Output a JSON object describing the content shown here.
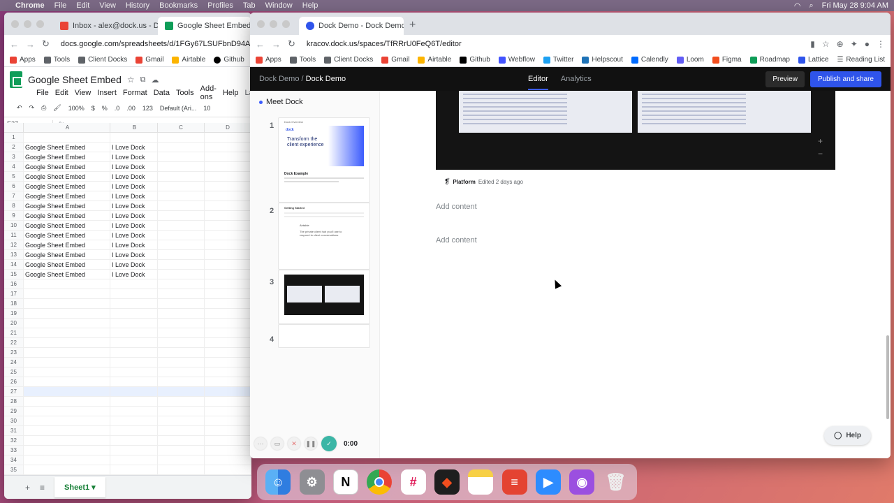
{
  "menubar": {
    "items": [
      "Chrome",
      "File",
      "Edit",
      "View",
      "History",
      "Bookmarks",
      "Profiles",
      "Tab",
      "Window",
      "Help"
    ],
    "clock": "Fri May 28  9:04 AM"
  },
  "sheets_window": {
    "tabs": [
      {
        "label": "Inbox - alex@dock.us - Dock M",
        "icon": "gmail-icon"
      },
      {
        "label": "Google Sheet Embed - Goog",
        "icon": "sheets-icon"
      }
    ],
    "url": "docs.google.com/spreadsheets/d/1FGy67LSUFbnD94AKgl",
    "bookmarks": [
      "Apps",
      "Tools",
      "Client Docks",
      "Gmail",
      "Airtable",
      "Github",
      "W"
    ],
    "doc_title": "Google Sheet Embed",
    "menus": [
      "File",
      "Edit",
      "View",
      "Insert",
      "Format",
      "Data",
      "Tools",
      "Add-ons",
      "Help",
      "La"
    ],
    "toolbar": {
      "zoom": "100%",
      "currency": "$",
      "percent": "%",
      "dec1": ".0",
      "dec2": ".00",
      "fmt": "123",
      "font": "Default (Ari...",
      "size": "10"
    },
    "cell_ref": "E27",
    "fx": "fx",
    "columns": [
      "A",
      "B",
      "C",
      "D"
    ],
    "rows": [
      {
        "n": "1",
        "a": "",
        "b": ""
      },
      {
        "n": "2",
        "a": "Google Sheet Embed",
        "b": "I Love Dock"
      },
      {
        "n": "3",
        "a": "Google Sheet Embed",
        "b": "I Love Dock"
      },
      {
        "n": "4",
        "a": "Google Sheet Embed",
        "b": "I Love Dock"
      },
      {
        "n": "5",
        "a": "Google Sheet Embed",
        "b": "I Love Dock"
      },
      {
        "n": "6",
        "a": "Google Sheet Embed",
        "b": "I Love Dock"
      },
      {
        "n": "7",
        "a": "Google Sheet Embed",
        "b": "I Love Dock"
      },
      {
        "n": "8",
        "a": "Google Sheet Embed",
        "b": "I Love Dock"
      },
      {
        "n": "9",
        "a": "Google Sheet Embed",
        "b": "I Love Dock"
      },
      {
        "n": "10",
        "a": "Google Sheet Embed",
        "b": "I Love Dock"
      },
      {
        "n": "11",
        "a": "Google Sheet Embed",
        "b": "I Love Dock"
      },
      {
        "n": "12",
        "a": "Google Sheet Embed",
        "b": "I Love Dock"
      },
      {
        "n": "13",
        "a": "Google Sheet Embed",
        "b": "I Love Dock"
      },
      {
        "n": "14",
        "a": "Google Sheet Embed",
        "b": "I Love Dock"
      },
      {
        "n": "15",
        "a": "Google Sheet Embed",
        "b": "I Love Dock"
      },
      {
        "n": "16",
        "a": "",
        "b": ""
      },
      {
        "n": "17",
        "a": "",
        "b": ""
      },
      {
        "n": "18",
        "a": "",
        "b": ""
      },
      {
        "n": "19",
        "a": "",
        "b": ""
      },
      {
        "n": "20",
        "a": "",
        "b": ""
      },
      {
        "n": "21",
        "a": "",
        "b": ""
      },
      {
        "n": "22",
        "a": "",
        "b": ""
      },
      {
        "n": "23",
        "a": "",
        "b": ""
      },
      {
        "n": "24",
        "a": "",
        "b": ""
      },
      {
        "n": "25",
        "a": "",
        "b": ""
      },
      {
        "n": "26",
        "a": "",
        "b": ""
      },
      {
        "n": "27",
        "a": "",
        "b": ""
      },
      {
        "n": "28",
        "a": "",
        "b": ""
      },
      {
        "n": "29",
        "a": "",
        "b": ""
      },
      {
        "n": "30",
        "a": "",
        "b": ""
      },
      {
        "n": "31",
        "a": "",
        "b": ""
      },
      {
        "n": "32",
        "a": "",
        "b": ""
      },
      {
        "n": "33",
        "a": "",
        "b": ""
      },
      {
        "n": "34",
        "a": "",
        "b": ""
      },
      {
        "n": "35",
        "a": "",
        "b": ""
      }
    ],
    "sheet_tab": "Sheet1"
  },
  "dock_window": {
    "tab": "Dock Demo - Dock Demo",
    "url": "kracov.dock.us/spaces/TfRRrU0FeQ6T/editor",
    "bookmarks": [
      "Apps",
      "Tools",
      "Client Docks",
      "Gmail",
      "Airtable",
      "Github",
      "Webflow",
      "Twitter",
      "Helpscout",
      "Calendly",
      "Loom",
      "Figma",
      "Roadmap",
      "Lattice"
    ],
    "reading_list": "Reading List",
    "breadcrumb_parent": "Dock Demo",
    "breadcrumb_sep": " / ",
    "breadcrumb_current": "Dock Demo",
    "tab_editor": "Editor",
    "tab_analytics": "Analytics",
    "preview": "Preview",
    "publish": "Publish and share",
    "section_title": "Meet Dock",
    "thumb_numbers": [
      "1",
      "2",
      "3",
      "4"
    ],
    "thumb1": {
      "heading": "Transform the client experience",
      "logo": "dock",
      "sub": "Dock Example",
      "label": "Dock Overview"
    },
    "thumb2": {
      "heading": "Getting Started",
      "app": "Airtable",
      "body": "The private client hub you'll use to respond to client conversations."
    },
    "embed_platform": "Platform",
    "embed_meta": "Edited 2 days ago",
    "add_content_1": "Add content",
    "add_content_2": "Add content",
    "help": "Help",
    "rec_time": "0:00"
  },
  "dock_apps": [
    "finder-icon",
    "settings-icon",
    "notion-icon",
    "chrome-icon",
    "slack-icon",
    "figma-icon",
    "notes-icon",
    "todoist-icon",
    "zoom-icon",
    "podcasts-icon",
    "trash-icon"
  ],
  "colors": {
    "accent": "#2f54eb",
    "sheets_green": "#0f9d58",
    "app_bar": "#111111"
  }
}
